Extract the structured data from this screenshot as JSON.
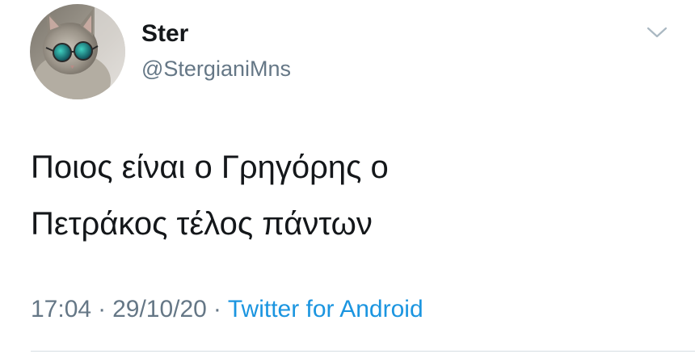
{
  "user": {
    "display_name": "Ster",
    "handle": "@StergianiMns"
  },
  "tweet": {
    "text_line1": "Ποιος είναι ο Γρηγόρης ο",
    "text_line2": "Πετράκος τέλος πάντων",
    "time": "17:04",
    "separator": "·",
    "date": "29/10/20",
    "source": "Twitter for Android"
  },
  "icons": {
    "avatar": "cat-with-sunglasses-avatar",
    "menu": "chevron-down-icon"
  },
  "colors": {
    "text": "#14171a",
    "secondary": "#657786",
    "link": "#1b95e0"
  }
}
